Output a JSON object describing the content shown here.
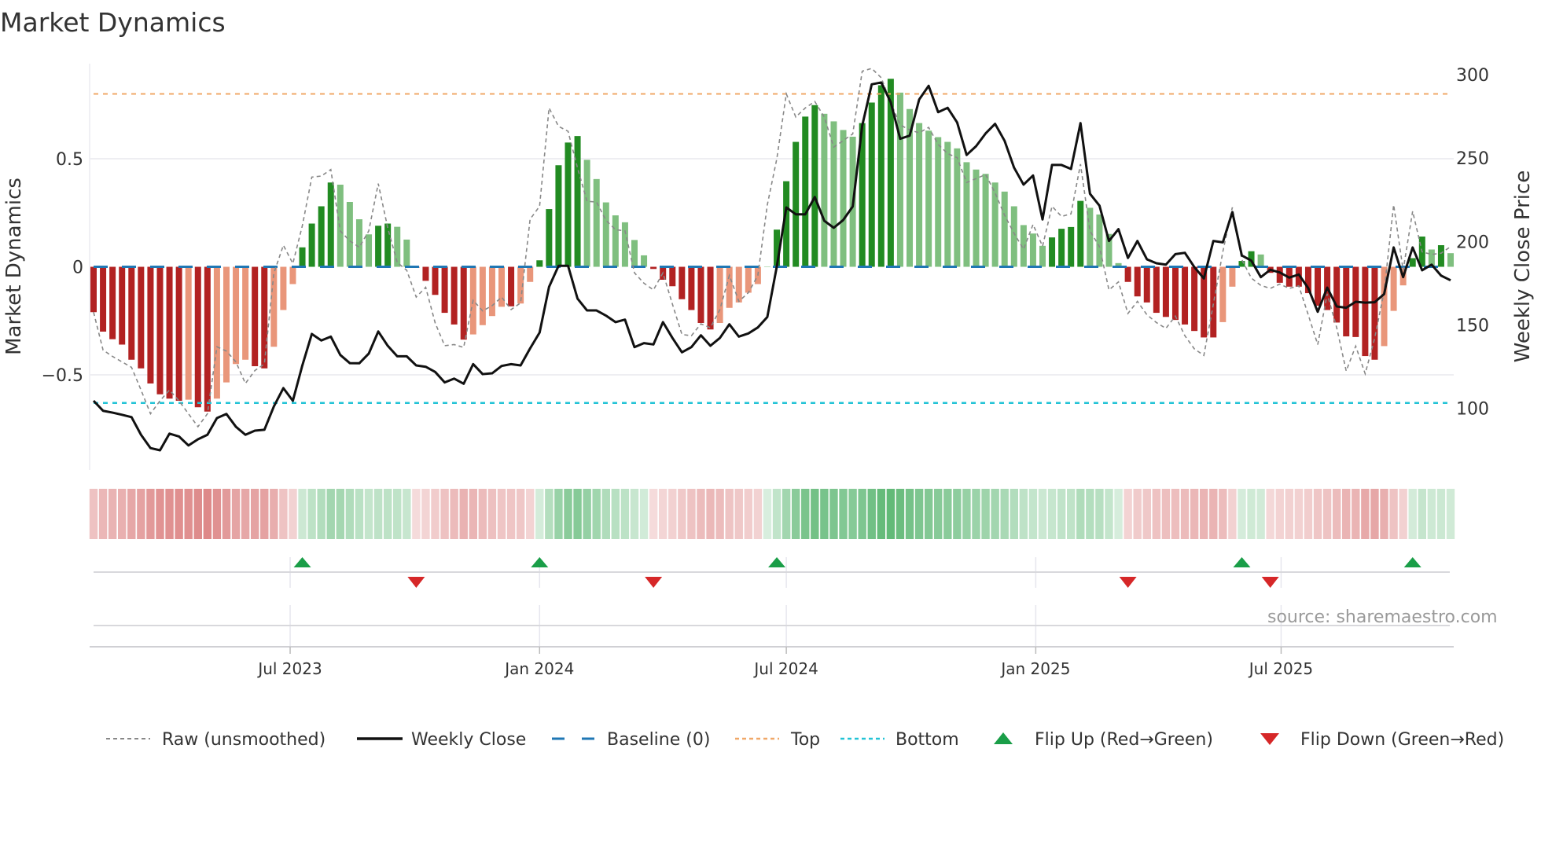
{
  "title": "Market Dynamics",
  "source": "source: sharemaestro.com",
  "legend": {
    "raw": "Raw (unsmoothed)",
    "close": "Weekly Close",
    "baseline": "Baseline (0)",
    "top": "Top",
    "bottom": "Bottom",
    "flip_up": "Flip Up (Red→Green)",
    "flip_down": "Flip Down (Green→Red)"
  },
  "colors": {
    "strong_green": "#228b22",
    "fading_green": "#7fbf7f",
    "strong_red": "#b22222",
    "fading_red": "#e9967a",
    "raw": "#888888",
    "close": "#111111",
    "baseline": "#1f77b4",
    "top": "#f0a868",
    "bottom": "#22c3d6",
    "flip_up": "#1a9e48",
    "flip_down": "#d62728"
  },
  "chart_data": {
    "type": "bar",
    "title": "Market Dynamics",
    "xlabel": "",
    "ylabel": "Market Dynamics",
    "y2label": "Weekly Close Price",
    "start_date": "2023-02-06",
    "frequency": "weekly",
    "ylim": [
      -0.94,
      0.94
    ],
    "y2lim": [
      62.9,
      306.7
    ],
    "yticks": [
      {
        "value": 0.5,
        "label": "0.5"
      },
      {
        "value": 0,
        "label": "0"
      },
      {
        "value": -0.5,
        "label": "−0.5"
      }
    ],
    "y2ticks": [
      {
        "value": 300,
        "label": "300"
      },
      {
        "value": 250,
        "label": "250"
      },
      {
        "value": 200,
        "label": "200"
      },
      {
        "value": 150,
        "label": "150"
      },
      {
        "value": 100,
        "label": "100"
      }
    ],
    "xticks": [
      {
        "label": "Jul 2023",
        "date": "2023-07-01"
      },
      {
        "label": "Jan 2024",
        "date": "2024-01-01"
      },
      {
        "label": "Jul 2024",
        "date": "2024-07-01"
      },
      {
        "label": "Jan 2025",
        "date": "2025-01-01"
      },
      {
        "label": "Jul 2025",
        "date": "2025-07-01"
      }
    ],
    "top_level": 0.8,
    "bottom_level": -0.63,
    "baseline": 0,
    "dynamics": [
      -0.21,
      -0.3,
      -0.335,
      -0.36,
      -0.43,
      -0.47,
      -0.54,
      -0.59,
      -0.61,
      -0.62,
      -0.615,
      -0.65,
      -0.67,
      -0.61,
      -0.535,
      -0.45,
      -0.43,
      -0.46,
      -0.47,
      -0.37,
      -0.2,
      -0.08,
      0.09,
      0.2,
      0.28,
      0.39,
      0.38,
      0.3,
      0.22,
      0.15,
      0.19,
      0.2,
      0.185,
      0.126,
      -0.005,
      -0.065,
      -0.13,
      -0.213,
      -0.267,
      -0.337,
      -0.313,
      -0.27,
      -0.228,
      -0.185,
      -0.183,
      -0.17,
      -0.07,
      0.03,
      0.267,
      0.47,
      0.575,
      0.605,
      0.495,
      0.406,
      0.298,
      0.238,
      0.206,
      0.124,
      0.053,
      -0.01,
      -0.06,
      -0.09,
      -0.15,
      -0.2,
      -0.26,
      -0.29,
      -0.26,
      -0.19,
      -0.165,
      -0.12,
      -0.08,
      0.0,
      0.172,
      0.396,
      0.578,
      0.695,
      0.748,
      0.708,
      0.673,
      0.633,
      0.602,
      0.665,
      0.76,
      0.84,
      0.87,
      0.806,
      0.73,
      0.665,
      0.63,
      0.6,
      0.578,
      0.548,
      0.484,
      0.45,
      0.43,
      0.39,
      0.348,
      0.28,
      0.193,
      0.154,
      0.097,
      0.136,
      0.176,
      0.184,
      0.305,
      0.273,
      0.242,
      0.152,
      0.017,
      -0.07,
      -0.137,
      -0.165,
      -0.213,
      -0.232,
      -0.246,
      -0.267,
      -0.297,
      -0.327,
      -0.327,
      -0.256,
      -0.092,
      0.027,
      0.072,
      0.057,
      -0.028,
      -0.074,
      -0.092,
      -0.092,
      -0.122,
      -0.18,
      -0.2,
      -0.258,
      -0.322,
      -0.325,
      -0.413,
      -0.43,
      -0.367,
      -0.204,
      -0.086,
      0.04,
      0.14,
      0.08,
      0.1,
      0.063
    ],
    "shade": "DDDDDDDDDDLDDLLLLDDLLLDDDDLLLLDDLLDDDDDDLLLLDLLDDDDDLLLLLLLDDDDDDDLLLLLLDDDDDLLLLDDDDLLLLLLLLLLLLLLLLDDDDLLLLDDDDDDDDDDLLDDLDDDDDDDDDDDDLLLDDLDL",
    "raw": [
      -0.21,
      -0.385,
      -0.415,
      -0.44,
      -0.465,
      -0.57,
      -0.68,
      -0.62,
      -0.57,
      -0.62,
      -0.68,
      -0.74,
      -0.68,
      -0.37,
      -0.39,
      -0.44,
      -0.54,
      -0.48,
      -0.45,
      -0.03,
      0.1,
      0.015,
      0.19,
      0.415,
      0.42,
      0.45,
      0.166,
      0.12,
      0.09,
      0.166,
      0.385,
      0.18,
      0.02,
      -0.016,
      -0.14,
      -0.095,
      -0.26,
      -0.365,
      -0.36,
      -0.373,
      -0.155,
      -0.204,
      -0.18,
      -0.14,
      -0.198,
      -0.167,
      0.22,
      0.28,
      0.735,
      0.65,
      0.627,
      0.457,
      0.303,
      0.3,
      0.215,
      0.172,
      0.166,
      -0.028,
      -0.076,
      -0.107,
      -0.028,
      -0.173,
      -0.313,
      -0.319,
      -0.264,
      -0.282,
      -0.198,
      -0.04,
      -0.16,
      -0.12,
      -0.04,
      0.287,
      0.5,
      0.8,
      0.693,
      0.735,
      0.765,
      0.693,
      0.554,
      0.584,
      0.615,
      0.905,
      0.918,
      0.875,
      0.76,
      0.657,
      0.633,
      0.62,
      0.645,
      0.566,
      0.524,
      0.505,
      0.39,
      0.408,
      0.427,
      0.342,
      0.239,
      0.155,
      0.081,
      0.196,
      0.095,
      0.28,
      0.233,
      0.245,
      0.475,
      0.166,
      0.093,
      -0.107,
      -0.07,
      -0.216,
      -0.16,
      -0.222,
      -0.258,
      -0.285,
      -0.228,
      -0.319,
      -0.38,
      -0.41,
      -0.173,
      0.07,
      0.275,
      0.033,
      -0.052,
      -0.086,
      -0.1,
      -0.08,
      -0.1,
      -0.088,
      -0.222,
      -0.36,
      -0.125,
      -0.282,
      -0.482,
      -0.367,
      -0.495,
      -0.33,
      -0.113,
      0.287,
      -0.016,
      0.257,
      0.069,
      0.057,
      0.063,
      0.093
    ],
    "close": [
      104.4,
      98.4,
      97.3,
      96,
      94.6,
      84,
      76,
      74.7,
      84.7,
      83,
      77.6,
      81.3,
      84,
      94,
      96.5,
      88.8,
      84,
      86.5,
      87,
      101,
      112,
      104.4,
      125.6,
      144.5,
      140.6,
      142.9,
      131.9,
      127,
      126.9,
      132.7,
      146,
      137.4,
      131.1,
      131.1,
      125.6,
      124.8,
      121.7,
      115.4,
      117.7,
      114.6,
      126.4,
      120.4,
      120.9,
      125.3,
      126.4,
      125.6,
      135.8,
      145.3,
      172.8,
      185.4,
      185.4,
      165.7,
      158.6,
      158.6,
      155.5,
      151.6,
      153.1,
      136.6,
      139,
      138.2,
      151.6,
      142.1,
      133.5,
      136.6,
      143.7,
      137.4,
      142.1,
      150.3,
      142.9,
      144.8,
      148.4,
      154.7,
      185,
      220.4,
      216.3,
      216.3,
      226.7,
      212.4,
      208.2,
      212.9,
      221,
      269.5,
      294.3,
      295.4,
      283.6,
      261.6,
      263.5,
      285.2,
      293.4,
      277.6,
      280.2,
      271.4,
      251.9,
      257.2,
      264.8,
      270.6,
      260.4,
      244.3,
      234.1,
      239.6,
      213.2,
      245.9,
      245.9,
      243.5,
      271,
      228.6,
      221.5,
      200.3,
      207.4,
      190.1,
      200.3,
      189.3,
      186.9,
      186.1,
      192.4,
      193.2,
      184.6,
      177.8,
      200.3,
      199.5,
      217.6,
      191.6,
      188.5,
      178.6,
      183,
      181.4,
      178.3,
      180.2,
      172,
      157.8,
      172.3,
      161,
      160.2,
      163.8,
      163.3,
      163.5,
      168.5,
      196.4,
      178.6,
      196.4,
      182.7,
      186.1,
      179.5,
      176.7
    ],
    "flip_up_weeks": [
      22,
      47,
      72,
      121,
      139
    ],
    "flip_down_weeks": [
      34,
      59,
      109,
      124
    ]
  }
}
